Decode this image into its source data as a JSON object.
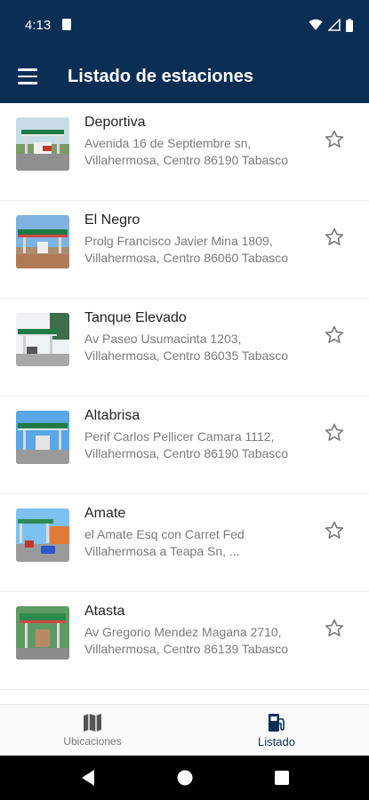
{
  "status_bar": {
    "time": "4:13"
  },
  "app_bar": {
    "title": "Listado de estaciones"
  },
  "stations": [
    {
      "name": "Deportiva",
      "address_line1": "Avenida 16 de Septiembre sn,",
      "address_line2": "Villahermosa, Centro 86190 Tabasco"
    },
    {
      "name": "El Negro",
      "address_line1": "Prolg Francisco Javier Mina 1809,",
      "address_line2": "Villahermosa, Centro 86060 Tabasco"
    },
    {
      "name": "Tanque Elevado",
      "address_line1": "Av Paseo Usumacinta 1203,",
      "address_line2": "Villahermosa, Centro 86035 Tabasco"
    },
    {
      "name": "Altabrisa",
      "address_line1": "Perif Carlos Pellicer Camara 1112,",
      "address_line2": "Villahermosa, Centro 86190 Tabasco"
    },
    {
      "name": "Amate",
      "address_line1": "el Amate Esq con Carret Fed",
      "address_line2": "Villahermosa a Teapa Sn, ..."
    },
    {
      "name": "Atasta",
      "address_line1": "Av Gregorio Mendez Magana 2710,",
      "address_line2": "Villahermosa, Centro 86139 Tabasco"
    }
  ],
  "bottom_nav": {
    "items": [
      {
        "label": "Ubicaciones",
        "icon": "map-icon",
        "active": false
      },
      {
        "label": "Listado",
        "icon": "gas-station-icon",
        "active": true
      }
    ]
  },
  "colors": {
    "primary": "#0b2e54",
    "background": "#ffffff",
    "secondary_text": "#7a7a7a"
  }
}
